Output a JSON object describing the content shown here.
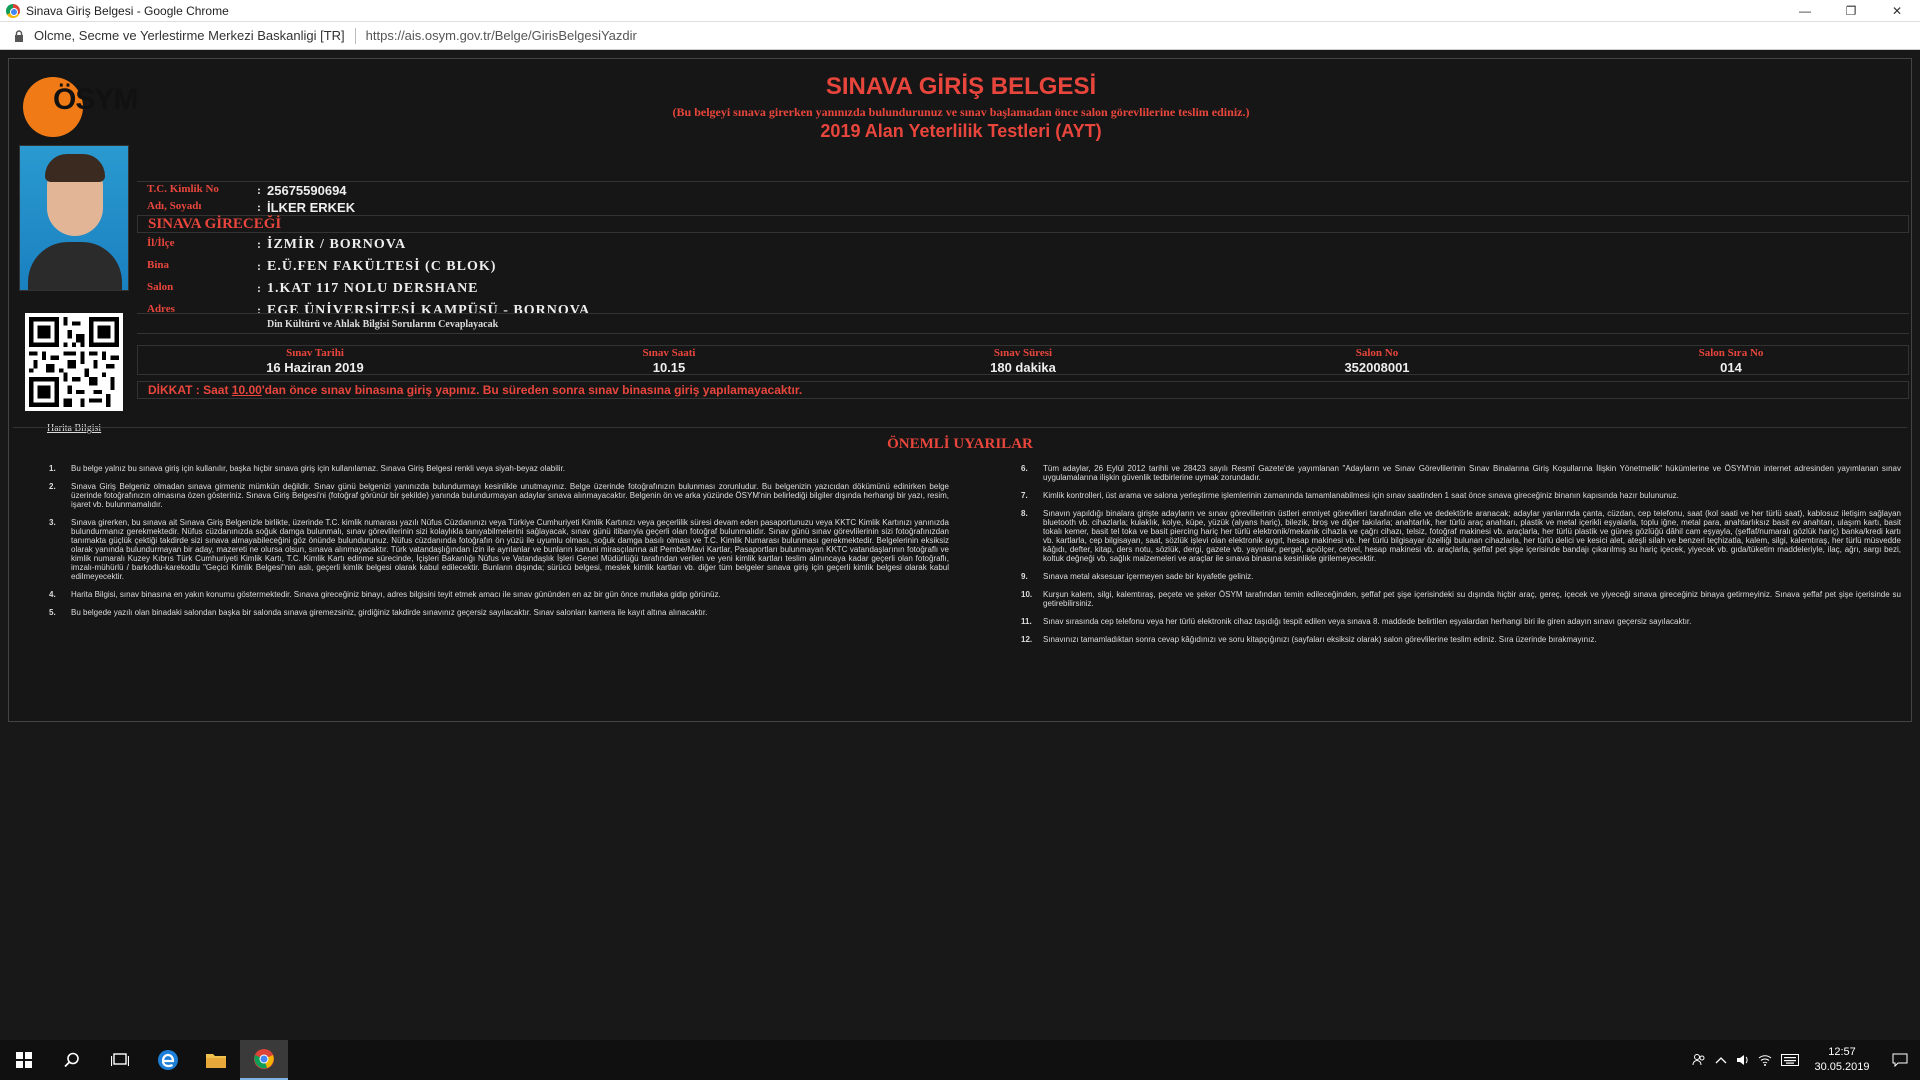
{
  "window": {
    "title": "Sinava Giriş Belgesi - Google Chrome",
    "controls": [
      "—",
      "❐",
      "✕"
    ]
  },
  "address": {
    "site": "Olcme, Secme ve Yerlestirme Merkezi Baskanligi [TR]",
    "url": "https://ais.osym.gov.tr/Belge/GirisBelgesiYazdir"
  },
  "doc": {
    "logo_text": "ÖSYM",
    "title": "SINAVA GİRİŞ BELGESİ",
    "note": "(Bu belgeyi sınava girerken yanınızda bulundurunuz ve sınav başlamadan önce salon görevlilerine teslim ediniz.)",
    "exam_name": "2019 Alan Yeterlilik Testleri (AYT)",
    "candidate": {
      "tc_label": "T.C. Kimlik No",
      "tc_value": "25675590694",
      "name_label": "Adı, Soyadı",
      "name_value": "İLKER ERKEK"
    },
    "section_label": "SINAVA GİRECEĞİ",
    "location": {
      "city_label": "İl/İlçe",
      "city_value": "İZMİR / BORNOVA",
      "building_label": "Bina",
      "building_value": "E.Ü.FEN FAKÜLTESİ (C BLOK)",
      "hall_label": "Salon",
      "hall_value": "1.KAT 117 NOLU DERSHANE",
      "address_label": "Adres",
      "address_value": "EGE ÜNİVERSİTESİ KAMPÜSÜ - BORNOVA"
    },
    "culture_note": "Din Kültürü ve Ahlak Bilgisi Sorularını Cevaplayacak",
    "exam_table": {
      "date_h": "Sınav Tarihi",
      "date_v": "16 Haziran 2019",
      "time_h": "Sınav Saati",
      "time_v": "10.15",
      "duration_h": "Sınav Süresi",
      "duration_v": "180 dakika",
      "hall_h": "Salon No",
      "hall_v": "352008001",
      "seat_h": "Salon Sıra No",
      "seat_v": "014"
    },
    "warning": {
      "prefix": "DİKKAT : Saat ",
      "time": "10.00",
      "suffix": "'dan önce sınav binasına giriş yapınız. Bu süreden sonra sınav binasına giriş yapılamayacaktır."
    },
    "map_link": "Harita Bilgisi",
    "rules_title": "ÖNEMLİ UYARILAR",
    "rules_left": [
      {
        "num": "1.",
        "text": "Bu belge yalnız bu sınava giriş için kullanılır, başka hiçbir sınava giriş için kullanılamaz. Sınava Giriş Belgesi renkli veya siyah-beyaz olabilir."
      },
      {
        "num": "2.",
        "text": "Sınava Giriş Belgeniz olmadan sınava girmeniz mümkün değildir. Sınav günü belgenizi yanınızda bulundurmayı kesinlikle unutmayınız. Belge üzerinde fotoğrafınızın bulunması zorunludur. Bu belgenizin yazıcıdan dökümünü edinirken belge üzerinde fotoğrafınızın olmasına özen gösteriniz. Sınava Giriş Belgesi'ni (fotoğraf görünür bir şekilde) yanında bulundurmayan adaylar sınava alınmayacaktır. Belgenin ön ve arka yüzünde ÖSYM'nin belirlediği bilgiler dışında herhangi bir yazı, resim, işaret vb. bulunmamalıdır."
      },
      {
        "num": "3.",
        "text": "Sınava girerken, bu sınava ait Sınava Giriş Belgenizle birlikte, üzerinde T.C. kimlik numarası yazılı Nüfus Cüzdanınızı veya Türkiye Cumhuriyeti Kimlik Kartınızı veya geçerlilik süresi devam eden pasaportunuzu veya KKTC Kimlik Kartınızı yanınızda bulundurmanız gerekmektedir. Nüfus cüzdanınızda soğuk damga bulunmalı, sınav görevlilerinin sizi kolaylıkla tanıyabilmelerini sağlayacak, sınav günü itibarıyla geçerli olan fotoğraf bulunmalıdır. Sınav günü sınav görevlilerinin sizi fotoğrafınızdan tanımakta güçlük çektiği takdirde sizi sınava almayabileceğini göz önünde bulundurunuz. Nüfus cüzdanında fotoğrafın ön yüzü ile uyumlu olması, soğuk damga basılı olması ve T.C. Kimlik Numarası bulunması gerekmektedir. Belgelerinin eksiksiz olarak yanında bulundurmayan bir aday, mazereti ne olursa olsun, sınava alınmayacaktır. Türk vatandaşlığından izin ile ayrılanlar ve bunların kanuni mirasçılarına ait Pembe/Mavi Kartlar, Pasaportları bulunmayan KKTC vatandaşlarının fotoğraflı ve kimlik numaralı Kuzey Kıbrıs Türk Cumhuriyeti Kimlik Kartı, T.C. Kimlik Kartı edinme sürecinde, İçişleri Bakanlığı Nüfus ve Vatandaşlık İşleri Genel Müdürlüğü tarafından verilen ve yeni kimlik kartları teslim alınıncaya kadar geçerli olan fotoğraflı, imzalı-mühürlü / barkodlu-karekodlu \"Geçici Kimlik Belgesi\"nin aslı, geçerli kimlik belgesi olarak kabul edilecektir. Bunların dışında; sürücü belgesi, meslek kimlik kartları vb. diğer tüm belgeler sınava giriş için geçerli kimlik belgesi olarak kabul edilmeyecektir."
      },
      {
        "num": "4.",
        "text": "Harita Bilgisi, sınav binasına en yakın konumu göstermektedir. Sınava gireceğiniz binayı, adres bilgisini teyit etmek amacı ile sınav gününden en az bir gün önce mutlaka gidip görünüz."
      },
      {
        "num": "5.",
        "text": "Bu belgede yazılı olan binadaki salondan başka bir salonda sınava giremezsiniz, girdiğiniz takdirde sınavınız geçersiz sayılacaktır. Sınav salonları kamera ile kayıt altına alınacaktır."
      }
    ],
    "rules_right": [
      {
        "num": "6.",
        "text": "Tüm adaylar, 26 Eylül 2012 tarihli ve 28423 sayılı Resmî Gazete'de yayımlanan \"Adayların ve Sınav Görevlilerinin Sınav Binalarına Giriş Koşullarına İlişkin Yönetmelik\" hükümlerine ve ÖSYM'nin internet adresinden yayımlanan sınav uygulamalarına ilişkin güvenlik tedbirlerine uymak zorundadır."
      },
      {
        "num": "7.",
        "text": "Kimlik kontrolleri, üst arama ve salona yerleştirme işlemlerinin zamanında tamamlanabilmesi için sınav saatinden 1 saat önce sınava gireceğiniz binanın kapısında hazır bulununuz."
      },
      {
        "num": "8.",
        "text": "Sınavın yapıldığı binalara girişte adayların ve sınav görevlilerinin üstleri emniyet görevlileri tarafından elle ve dedektörle aranacak; adaylar yanlarında çanta, cüzdan, cep telefonu, saat (kol saati ve her türlü saat), kablosuz iletişim sağlayan bluetooth vb. cihazlarla; kulaklık, kolye, küpe, yüzük (alyans hariç), bilezik, broş ve diğer takılarla; anahtarlık, her türlü araç anahtarı, plastik ve metal içerikli eşyalarla, toplu iğne, metal para, anahtarlıksız basit ev anahtarı, ulaşım kartı, basit tokalı kemer, basit tel toka ve basit piercing hariç her türlü elektronik/mekanik cihazla ve çağrı cihazı, telsiz, fotoğraf makinesi vb. araçlarla, her türlü plastik ve güneş gözlüğü dâhil cam eşyayla, (şeffaf/numaralı gözlük hariç) banka/kredi kartı vb. kartlarla, cep bilgisayarı, saat, sözlük işlevi olan elektronik aygıt, hesap makinesi vb. her türlü bilgisayar özelliği bulunan cihazlarla, her türlü delici ve kesici alet, ateşli silah ve benzeri teçhizatla, kalem, silgi, kalemtıraş, her türlü müsvedde kâğıdı, defter, kitap, ders notu, sözlük, dergi, gazete vb. yayınlar, pergel, açıölçer, cetvel, hesap makinesi vb. araçlarla, şeffaf pet şişe içerisinde bandajı çıkarılmış su hariç içecek, yiyecek vb. gıda/tüketim maddeleriyle, ilaç, ağrı, sargı bezi, koltuk değneği vb. sağlık malzemeleri ve araçlar ile sınava binasına kesinlikle girilemeyecektir."
      },
      {
        "num": "9.",
        "text": "Sınava metal aksesuar içermeyen sade bir kıyafetle geliniz."
      },
      {
        "num": "10.",
        "text": "Kurşun kalem, silgi, kalemtıraş, peçete ve şeker ÖSYM tarafından temin edileceğinden, şeffaf pet şişe içerisindeki su dışında hiçbir araç, gereç, içecek ve yiyeceği sınava gireceğiniz binaya getirmeyiniz. Sınava şeffaf pet şişe içerisinde su getirebilirsiniz."
      },
      {
        "num": "11.",
        "text": "Sınav sırasında cep telefonu veya her türlü elektronik cihaz taşıdığı tespit edilen veya sınava 8. maddede belirtilen eşyalardan herhangi biri ile giren adayın sınavı geçersiz sayılacaktır."
      },
      {
        "num": "12.",
        "text": "Sınavınızı tamamladıktan sonra cevap kâğıdınızı ve soru kitapçığınızı (sayfaları eksiksiz olarak) salon görevlilerine teslim ediniz. Sıra üzerinde bırakmayınız."
      }
    ]
  },
  "taskbar": {
    "time": "12:57",
    "date": "30.05.2019"
  }
}
